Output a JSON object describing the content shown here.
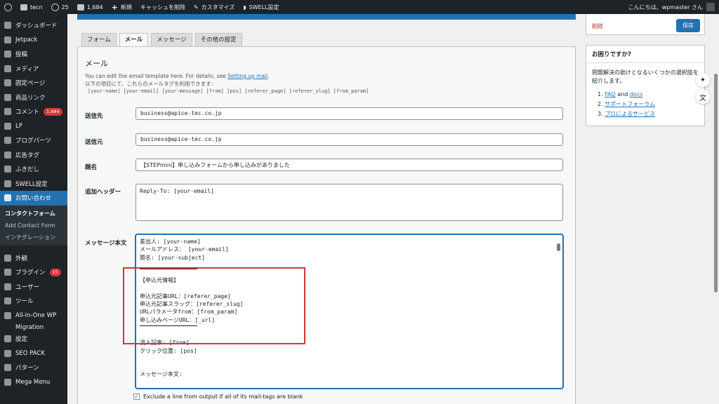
{
  "adminbar": {
    "site": "tecn",
    "updates": "25",
    "comments": "1,684",
    "new": "新規",
    "cache": "キャッシュを削除",
    "customize": "カスタマイズ",
    "swell": "SWELL設定",
    "greeting": "こんにちは、wpmaster さん"
  },
  "sidebar": {
    "items": [
      {
        "label": "ダッシュボード",
        "icon": "dashboard-icon"
      },
      {
        "label": "Jetpack",
        "icon": "jetpack-icon"
      },
      {
        "label": "投稿",
        "icon": "pin-icon"
      },
      {
        "label": "メディア",
        "icon": "media-icon"
      },
      {
        "label": "固定ページ",
        "icon": "page-icon"
      },
      {
        "label": "商品リンク",
        "icon": "product-icon"
      },
      {
        "label": "コメント",
        "icon": "comment-icon",
        "badge": "1,684"
      },
      {
        "label": "LP",
        "icon": "lp-icon"
      },
      {
        "label": "ブログパーツ",
        "icon": "blog-parts-icon"
      },
      {
        "label": "広告タグ",
        "icon": "ad-tag-icon"
      },
      {
        "label": "ふきだし",
        "icon": "balloon-icon"
      },
      {
        "label": "SWELL設定",
        "icon": "swell-icon"
      }
    ],
    "current": {
      "label": "お問い合わせ",
      "icon": "mail-icon"
    },
    "submenu": [
      "コンタクトフォーム",
      "Add Contact Form",
      "インテグレーション"
    ],
    "items2": [
      {
        "label": "外観",
        "icon": "appearance-icon"
      },
      {
        "label": "プラグイン",
        "icon": "plugin-icon",
        "badge": "15"
      },
      {
        "label": "ユーザー",
        "icon": "user-icon"
      },
      {
        "label": "ツール",
        "icon": "tools-icon"
      },
      {
        "label": "All-in-One WP",
        "icon": "migration-icon"
      },
      {
        "label": "Migration",
        "icon": ""
      },
      {
        "label": "設定",
        "icon": "settings-icon"
      },
      {
        "label": "SEO PACK",
        "icon": "seo-icon"
      },
      {
        "label": "パターン",
        "icon": "pattern-icon"
      },
      {
        "label": "Mega Menu",
        "icon": "mega-menu-icon"
      }
    ]
  },
  "tabs": [
    "フォーム",
    "メール",
    "メッセージ",
    "その他の設定"
  ],
  "mail": {
    "title": "メール",
    "desc_prefix": "You can edit the email template here. For details, see",
    "desc_link": "Setting up mail",
    "desc_line2": "以下の項目にて、これらのメールタグを利用できます:",
    "tags": "[your-name] [your-email] [your-message] [from] [pos] [referer_page] [referer_slug] [from_param]",
    "to_label": "送信先",
    "to_value": "business@apice-tec.co.jp",
    "from_label": "送信元",
    "from_value": "business@apice-tec.co.jp",
    "subject_label": "題名",
    "subject_value": "【STEPmini】申し込みフォームから申し込みがありました",
    "headers_label": "追加ヘッダー",
    "headers_value": "Reply-To: [your-email]",
    "body_label": "メッセージ本文",
    "body_lines_a": [
      "差出人: [your-name]",
      "メールアドレス： [your-email]",
      "題名: [your-subject]"
    ],
    "body_lines_b": [
      "",
      "【申込元情報】",
      "",
      "申込元記事URL：[referer_page]",
      "申込元記事スラッグ：[referer_slug]",
      "URLパラメータfrom：[from_param]",
      "申し込みページURL：[_url]"
    ],
    "body_lines_c": [
      "",
      "流入記事: [from]",
      "クリック位置: [pos]",
      "",
      "",
      "メッセージ本文:"
    ],
    "exclude_label": "Exclude a line from output if all of its mail-tags are blank"
  },
  "publish": {
    "delete": "削除",
    "save": "保存"
  },
  "help": {
    "title": "お困りですか?",
    "text": "問題解決の助けとなるいくつかの選択肢を紹介します。",
    "faq": "FAQ",
    "and": "and",
    "docs": "docs",
    "forum": "サポートフォーラム",
    "pro": "プロによるサービス"
  }
}
